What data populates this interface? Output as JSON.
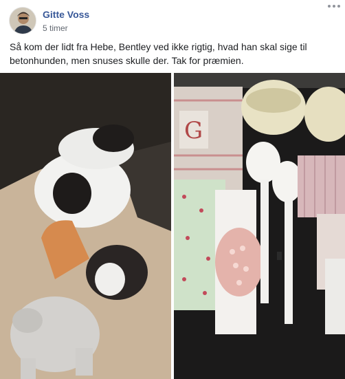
{
  "post": {
    "author": "Gitte Voss",
    "timestamp": "5 timer",
    "text": "Så kom der lidt fra Hebe, Bentley ved ikke rigtig, hvad han skal sige til betonhunden, men snuses skulle der. Tak for præmien.",
    "more_icon": "more-options-icon",
    "photos": [
      {
        "name": "dog-with-concrete-dog-photo"
      },
      {
        "name": "prize-items-photo"
      }
    ]
  },
  "colors": {
    "author_link": "#385898",
    "secondary_text": "#616770",
    "body_text": "#1c1e21"
  }
}
